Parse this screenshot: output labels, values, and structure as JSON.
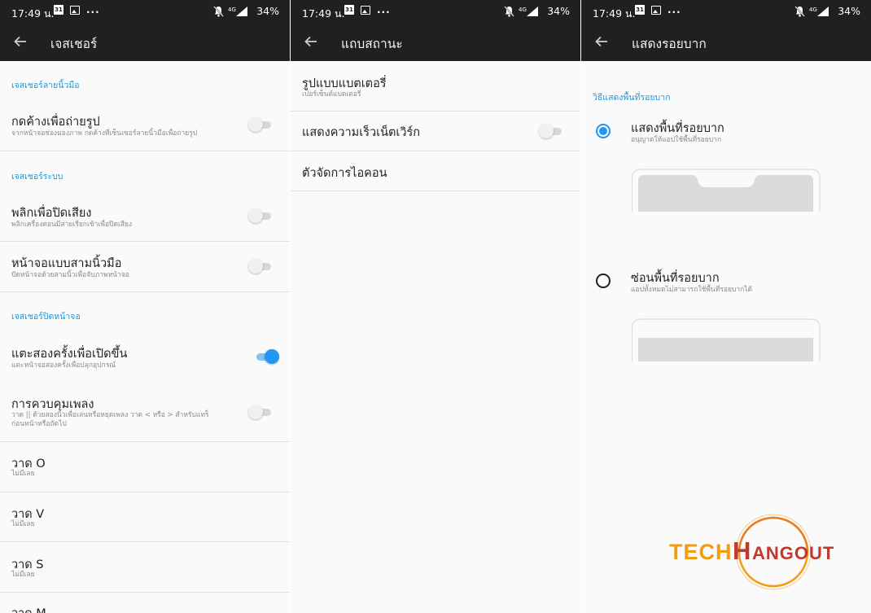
{
  "status_bar": {
    "time": "17:49 น.",
    "calendar_day": "31",
    "more": "...",
    "network": "4G",
    "battery": "34%"
  },
  "panel1": {
    "title": "เจสเชอร์",
    "sections": [
      {
        "header": "เจสเชอร์ลายนิ้วมือ"
      },
      {
        "header": "เจสเชอร์ระบบ"
      },
      {
        "header": "เจสเชอร์ปิดหน้าจอ"
      }
    ],
    "items": [
      {
        "title": "กดค้างเพื่อถ่ายรูป",
        "subtitle": "จากหน้าจอช่องมองภาพ กดค้างที่เซ็นเซอร์ลายนิ้วมือเพื่อถ่ายรูป",
        "enabled": false
      },
      {
        "title": "พลิกเพื่อปิดเสียง",
        "subtitle": "พลิกเครื่องตอนมีสายเรียกเข้าเพื่อปิดเสียง",
        "enabled": false
      },
      {
        "title": "หน้าจอแบบสามนิ้วมือ",
        "subtitle": "ปัดหน้าจอด้วยสามนิ้วเพื่อจับภาพหน้าจอ",
        "enabled": false
      },
      {
        "title": "แตะสองครั้งเพื่อเปิดขึ้น",
        "subtitle": "แตะหน้าจอสองครั้งเพื่อปลุกอุปกรณ์",
        "enabled": true
      },
      {
        "title": "การควบคุมเพลง",
        "subtitle": "วาด || ด้วยสองนิ้วเพื่อเล่นหรือหยุดเพลง วาด < หรือ > สำหรับแทร็",
        "subtitle2": "ก่อนหน้าหรือถัดไป",
        "enabled": false
      },
      {
        "title": "วาด O",
        "subtitle": "ไม่มีเลย"
      },
      {
        "title": "วาด V",
        "subtitle": "ไม่มีเลย"
      },
      {
        "title": "วาด S",
        "subtitle": "ไม่มีเลย"
      },
      {
        "title": "วาด M"
      }
    ]
  },
  "panel2": {
    "title": "แถบสถานะ",
    "items": [
      {
        "title": "รูปแบบแบตเตอรี่",
        "subtitle": "เปอร์เซ็นต์แบตเตอรี่"
      },
      {
        "title": "แสดงความเร็วเน็ตเวิร์ก",
        "enabled": false
      },
      {
        "title": "ตัวจัดการไอคอน"
      }
    ]
  },
  "panel3": {
    "title": "แสดงรอยบาก",
    "section": "วิธีแสดงพื้นที่รอยบาก",
    "options": [
      {
        "title": "แสดงพื้นที่รอยบาก",
        "subtitle": "อนุญาตให้แอปใช้พื้นที่รอยบาก",
        "selected": true
      },
      {
        "title": "ซ่อนพื้นที่รอยบาก",
        "subtitle": "แอปทั้งหมดไม่สามารถใช้พื้นที่รอยบากได้",
        "selected": false
      }
    ]
  },
  "watermark": {
    "text": "TECHHANGOUT",
    "colors": {
      "orange": "#f39c12",
      "red": "#c0392b"
    }
  },
  "colors": {
    "accent": "#2196f3",
    "section": "#2196d6",
    "toolbar": "#202020"
  }
}
